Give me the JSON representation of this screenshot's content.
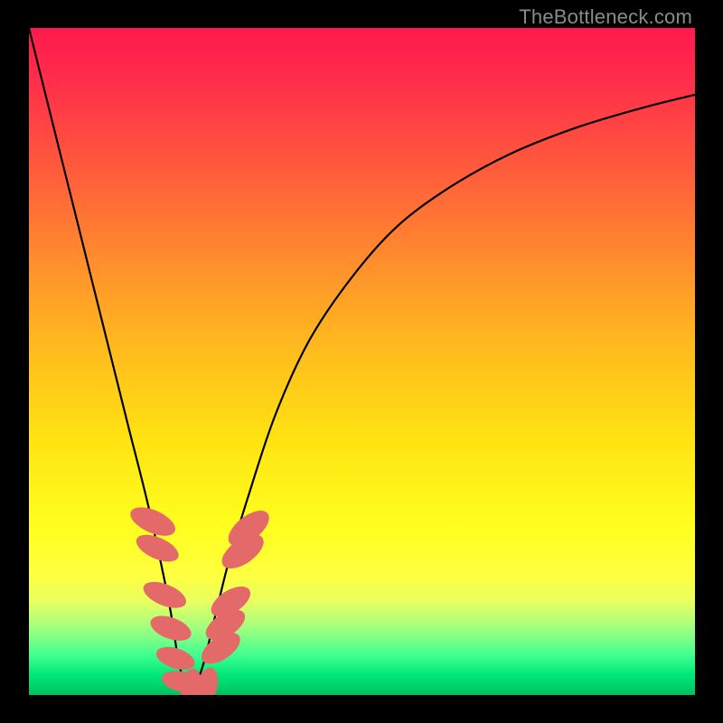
{
  "watermark": "TheBottleneck.com",
  "chart_data": {
    "type": "line",
    "title": "",
    "xlabel": "",
    "ylabel": "",
    "xlim": [
      0,
      100
    ],
    "ylim": [
      0,
      100
    ],
    "series": [
      {
        "name": "bottleneck-curve",
        "x": [
          0,
          3,
          6,
          9,
          12,
          15,
          18,
          21,
          22.5,
          24,
          26,
          28,
          30,
          33,
          37,
          42,
          48,
          55,
          63,
          72,
          82,
          92,
          100
        ],
        "y": [
          100,
          88,
          76,
          64,
          52,
          40,
          28,
          14,
          5,
          0,
          4,
          12,
          20,
          30,
          42,
          53,
          62,
          70,
          76,
          81,
          85,
          88,
          90
        ]
      }
    ],
    "markers": [
      {
        "x": 18.6,
        "y": 26,
        "rx": 1.7,
        "ry": 3.6,
        "angle": -66
      },
      {
        "x": 19.3,
        "y": 22,
        "rx": 1.6,
        "ry": 3.4,
        "angle": -66
      },
      {
        "x": 20.4,
        "y": 15,
        "rx": 1.6,
        "ry": 3.4,
        "angle": -68
      },
      {
        "x": 21.3,
        "y": 10,
        "rx": 1.6,
        "ry": 3.2,
        "angle": -70
      },
      {
        "x": 22.0,
        "y": 5.5,
        "rx": 1.5,
        "ry": 3.0,
        "angle": -72
      },
      {
        "x": 22.9,
        "y": 2.0,
        "rx": 1.5,
        "ry": 3.0,
        "angle": -78
      },
      {
        "x": 24.4,
        "y": 0.6,
        "rx": 1.6,
        "ry": 3.4,
        "angle": 5
      },
      {
        "x": 26.6,
        "y": 1.0,
        "rx": 1.6,
        "ry": 3.2,
        "angle": 15
      },
      {
        "x": 28.8,
        "y": 7.0,
        "rx": 1.7,
        "ry": 3.3,
        "angle": 56
      },
      {
        "x": 29.5,
        "y": 10.5,
        "rx": 1.7,
        "ry": 3.3,
        "angle": 58
      },
      {
        "x": 30.3,
        "y": 14.0,
        "rx": 1.7,
        "ry": 3.3,
        "angle": 58
      },
      {
        "x": 32.1,
        "y": 21.5,
        "rx": 1.8,
        "ry": 3.6,
        "angle": 55
      },
      {
        "x": 33.0,
        "y": 25.0,
        "rx": 1.8,
        "ry": 3.6,
        "angle": 52
      }
    ],
    "marker_color": "#e46a6a",
    "curve_color": "#000000"
  }
}
